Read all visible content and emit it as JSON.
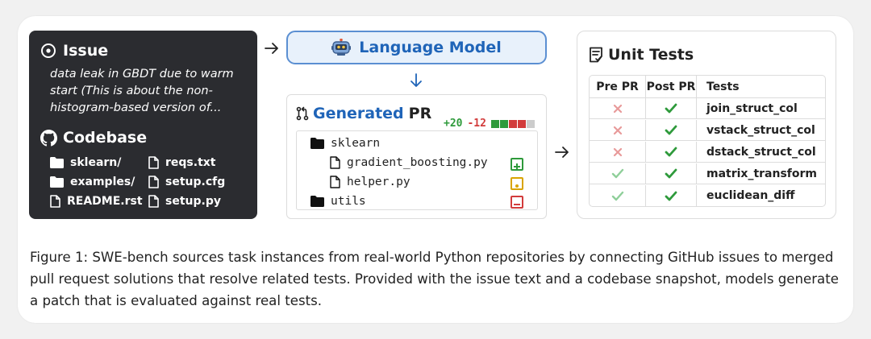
{
  "issue": {
    "title": "Issue",
    "text": "data leak in GBDT due to warm start (This is about the non-histogram-based version of..."
  },
  "codebase": {
    "title": "Codebase",
    "files": [
      {
        "name": "sklearn/",
        "type": "folder"
      },
      {
        "name": "reqs.txt",
        "type": "file"
      },
      {
        "name": "examples/",
        "type": "folder"
      },
      {
        "name": "setup.cfg",
        "type": "file"
      },
      {
        "name": "README.rst",
        "type": "file"
      },
      {
        "name": "setup.py",
        "type": "file"
      }
    ]
  },
  "language_model": {
    "title": "Language Model"
  },
  "generated_pr": {
    "title_part1": "Generated",
    "title_part2": "PR",
    "additions": "+20",
    "deletions": "-12",
    "diff_bar_colors": [
      "#2e9a3b",
      "#2e9a3b",
      "#d23b3b",
      "#d23b3b",
      "#cccccc"
    ],
    "tree": [
      {
        "name": "sklearn",
        "type": "folder",
        "change": "none"
      },
      {
        "name": "gradient_boosting.py",
        "type": "file",
        "change": "added"
      },
      {
        "name": "helper.py",
        "type": "file",
        "change": "modified"
      },
      {
        "name": "utils",
        "type": "folder",
        "change": "removed"
      }
    ]
  },
  "unit_tests": {
    "title": "Unit Tests",
    "headers": [
      "Pre PR",
      "Post PR",
      "Tests"
    ],
    "rows": [
      {
        "pre": "fail",
        "post": "pass",
        "test": "join_struct_col"
      },
      {
        "pre": "fail",
        "post": "pass",
        "test": "vstack_struct_col"
      },
      {
        "pre": "fail",
        "post": "pass",
        "test": "dstack_struct_col"
      },
      {
        "pre": "pass",
        "post": "pass",
        "test": "matrix_transform"
      },
      {
        "pre": "pass",
        "post": "pass",
        "test": "euclidean_diff"
      }
    ]
  },
  "colors": {
    "dark_panel": "#2b2c30",
    "accent_blue": "#1f64b8",
    "add_green": "#2e9a3b",
    "del_red": "#d23b3b",
    "modified_yellow": "#d9a400",
    "fail_light_red": "#e89a9a",
    "pass_light_green": "#8fcf9a",
    "pass_green": "#2e9a3b"
  },
  "caption": "Figure 1:  SWE-bench sources task instances from real-world Python repositories by connecting GitHub issues to merged pull request solutions that resolve related tests. Provided with the issue text and a codebase snapshot, models generate a patch that is evaluated against real tests."
}
